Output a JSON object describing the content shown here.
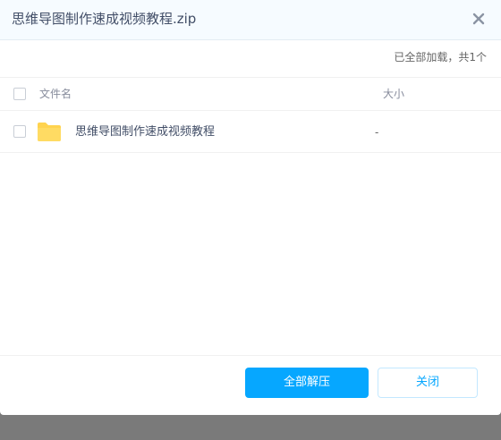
{
  "dialog": {
    "title": "思维导图制作速成视频教程.zip",
    "status": "已全部加载，共1个"
  },
  "table": {
    "headers": {
      "name": "文件名",
      "size": "大小"
    },
    "rows": [
      {
        "name": "思维导图制作速成视频教程",
        "size": "-",
        "icon": "folder-icon"
      }
    ]
  },
  "footer": {
    "extract_all_label": "全部解压",
    "close_label": "关闭"
  },
  "colors": {
    "accent": "#06a7ff",
    "header_bg": "#f6fbff",
    "folder": "#ffd34f",
    "backdrop": "#7a7a7a"
  }
}
